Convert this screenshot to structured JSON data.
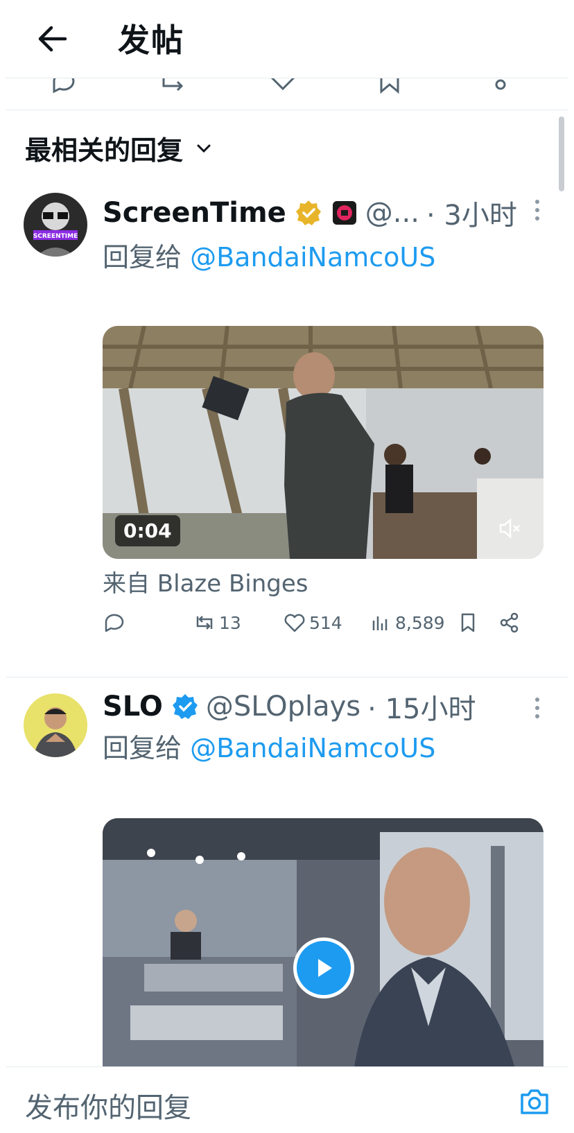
{
  "header": {
    "title": "发帖"
  },
  "sort": {
    "label": "最相关的回复"
  },
  "posts": [
    {
      "name": "ScreenTime",
      "handle": "@...",
      "time": "· 3小时",
      "reply_prefix": "回复给",
      "reply_to": "@BandaiNamcoUS",
      "video_duration": "0:04",
      "from_label": "来自 Blaze Binges",
      "retweets": "13",
      "likes": "514",
      "views": "8,589",
      "avatar_text": "SCREENTIME"
    },
    {
      "name": "SLO",
      "handle": "@SLOplays",
      "time": "· 15小时",
      "reply_prefix": "回复给",
      "reply_to": "@BandaiNamcoUS"
    }
  ],
  "composer": {
    "placeholder": "发布你的回复"
  },
  "colors": {
    "accent": "#1d9bf0",
    "gold_badge": "#e8b52a",
    "text_secondary": "#536471"
  }
}
